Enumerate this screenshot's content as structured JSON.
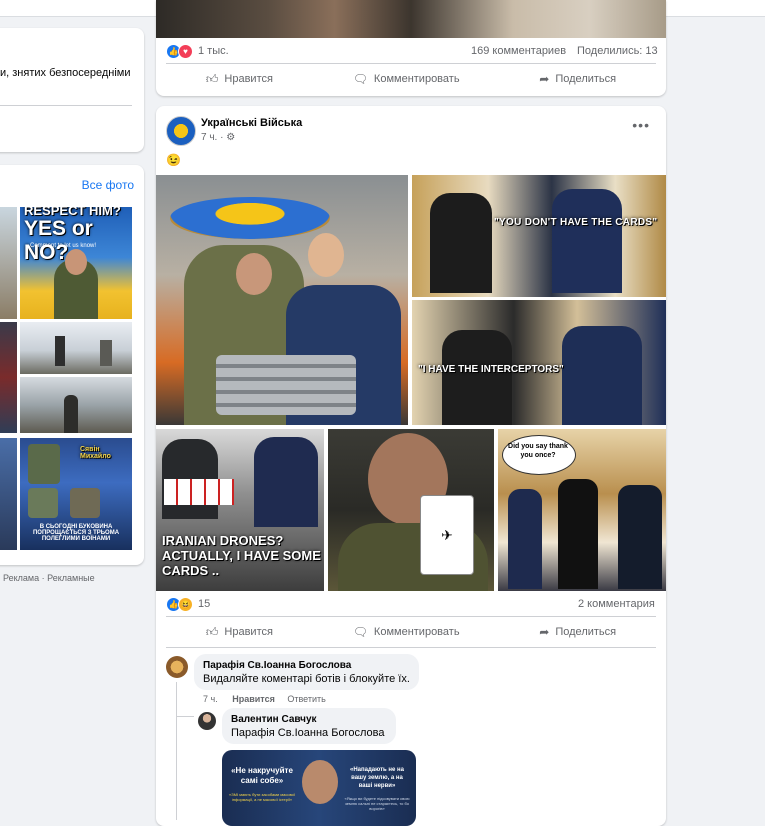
{
  "sidebar": {
    "snippet": "и, знятих безпосередніми",
    "all_photos": "Все фото",
    "photo_captions": {
      "respect": "RESPECT HIM?",
      "yes_or_no": "YES or NO?",
      "comment": "Comment to let us know!",
      "savin": "Сявін Михайло",
      "bukovyna": "В СЬОГОДНІ БУКОВИНА ПОПРОЩАЄТЬСЯ З ТРЬОМА ПОЛЕГЛИМИ ВОЇНАМИ"
    },
    "ad": "Реклама · Рекламные"
  },
  "post1": {
    "reactions_count": "1 тыс.",
    "comments_count": "169 комментариев",
    "shares_count": "Поделились: 13",
    "like": "Нравится",
    "comment": "Комментировать",
    "share": "Поделиться"
  },
  "post2": {
    "author": "Українські Війська",
    "time": "7 ч. ·",
    "emoji": "😉",
    "captions": {
      "cards": "\"YOU DON'T HAVE THE CARDS\"",
      "interceptors": "\"I HAVE THE INTERCEPTORS\"",
      "drones": "IRANIAN DRONES? ACTUALLY, I HAVE SOME CARDS ..",
      "thank": "Did you say thank you once?"
    },
    "reactions_count": "15",
    "comments_count": "2 комментария",
    "like": "Нравится",
    "comment": "Комментировать",
    "share": "Поделиться"
  },
  "comments": [
    {
      "author": "Парафія Св.Іоанна Богослова",
      "text": "Видаляйте коментарі ботів і блокуйте їх.",
      "time": "7 ч.",
      "like": "Нравится",
      "reply": "Ответить"
    },
    {
      "author": "Валентин Савчук",
      "text": "Парафія Св.Іоанна Богослова",
      "image_captions": {
        "left": "«Не накручуйте самі собе»",
        "left_sub": "«ЗМІ мають бути засобами масової інформації, а не масової істерії»",
        "right": "«Нападають не на вашу землю, а на ваші нерви»",
        "right_sub": "«Якщо ви будете підсовувати свою землю сальні не стараєтесь, то бо ворогів»"
      }
    }
  ]
}
